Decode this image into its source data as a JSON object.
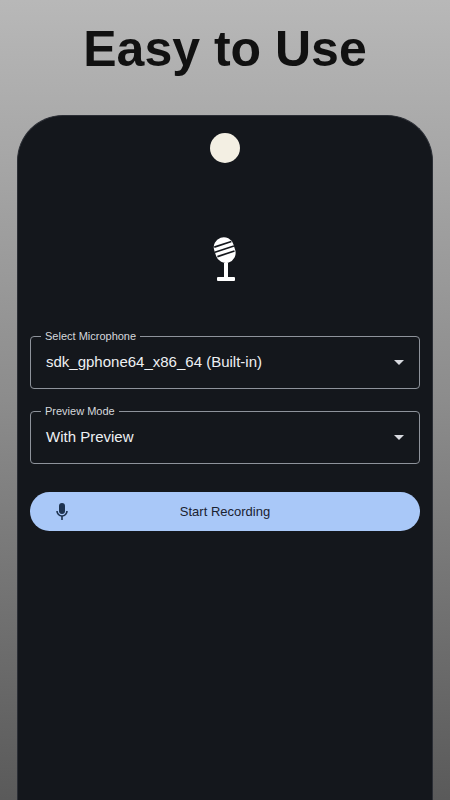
{
  "headline": "Easy to Use",
  "fields": [
    {
      "label": "Select Microphone",
      "value": "sdk_gphone64_x86_64 (Built-in)"
    },
    {
      "label": "Preview Mode",
      "value": "With Preview"
    }
  ],
  "record_button": {
    "label": "Start Recording"
  }
}
